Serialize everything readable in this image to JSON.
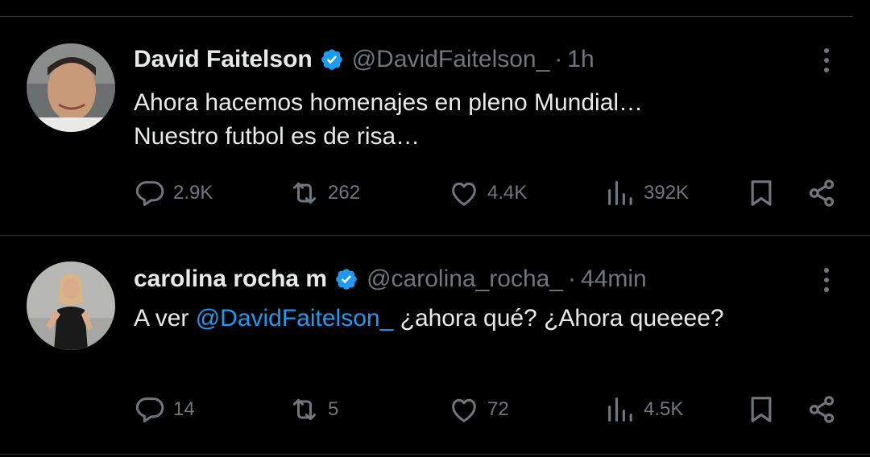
{
  "tweets": [
    {
      "name": "David Faitelson",
      "handle": "@DavidFaitelson_",
      "separator": "·",
      "time": "1h",
      "text_lines": [
        "Ahora hacemos homenajes en pleno Mundial…",
        "Nuestro futbol es de risa…"
      ],
      "replies": "2.9K",
      "reposts": "262",
      "likes": "4.4K",
      "views": "392K"
    },
    {
      "name": "carolina rocha m",
      "handle": "@carolina_rocha_",
      "separator": "·",
      "time": "44min",
      "text_before": "A ver ",
      "mention": "@DavidFaitelson_",
      "text_after": " ¿ahora qué? ¿Ahora queeee?",
      "replies": "14",
      "reposts": "5",
      "likes": "72",
      "views": "4.5K"
    }
  ],
  "colors": {
    "background": "#000000",
    "text_primary": "#e7e9ea",
    "text_secondary": "#71767b",
    "accent": "#1d9bf0",
    "divider": "#2f3336"
  },
  "icons": [
    "verified-badge-icon",
    "more-options-icon",
    "reply-icon",
    "repost-icon",
    "like-icon",
    "views-icon",
    "bookmark-icon",
    "share-icon"
  ]
}
